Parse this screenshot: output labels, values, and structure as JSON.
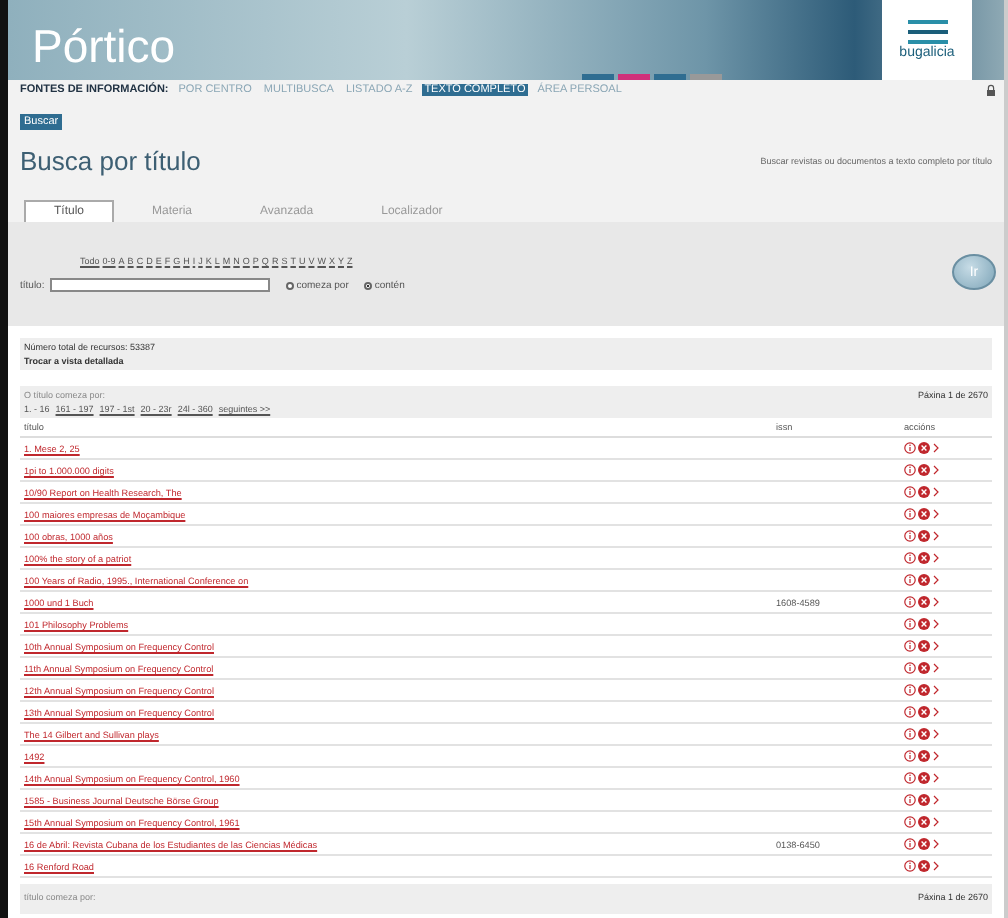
{
  "header": {
    "logo": "Pórtico",
    "brand": "bugalicia"
  },
  "nav": {
    "label": "FONTES DE INFORMACIÓN:",
    "items": [
      {
        "label": "POR CENTRO",
        "selected": false
      },
      {
        "label": "MULTIBUSCA",
        "selected": false
      },
      {
        "label": "LISTADO A-Z",
        "selected": false
      },
      {
        "label": "TEXTO COMPLETO",
        "selected": true
      },
      {
        "label": "ÁREA PERSOAL",
        "selected": false
      }
    ],
    "sub_button": "Buscar"
  },
  "page": {
    "title": "Busca por título",
    "description": "Buscar revistas ou documentos a texto completo por título"
  },
  "tabs": [
    {
      "label": "Título",
      "selected": true
    },
    {
      "label": "Materia",
      "selected": false
    },
    {
      "label": "Avanzada",
      "selected": false
    },
    {
      "label": "Localizador",
      "selected": false
    }
  ],
  "search": {
    "letters": [
      "Todo",
      "0-9",
      "A",
      "B",
      "C",
      "D",
      "E",
      "F",
      "G",
      "H",
      "I",
      "J",
      "K",
      "L",
      "M",
      "N",
      "O",
      "P",
      "Q",
      "R",
      "S",
      "T",
      "U",
      "V",
      "W",
      "X",
      "Y",
      "Z"
    ],
    "field_label": "título:",
    "options": [
      {
        "label": "comeza por",
        "selected": false
      },
      {
        "label": "contén",
        "selected": true
      }
    ],
    "go_button": "Ir"
  },
  "summary": {
    "total": "Número total de recursos: 53387",
    "view_link": "Trocar a vista detallada"
  },
  "results": {
    "prefix_label": "O título comeza por:",
    "page_info": "Páxina 1 de 2670",
    "pages": [
      {
        "label": "1. - 16",
        "selected": true
      },
      {
        "label": "161 - 197",
        "selected": false
      },
      {
        "label": "197 - 1st",
        "selected": false
      },
      {
        "label": "20 - 23r",
        "selected": false
      },
      {
        "label": "24l - 360",
        "selected": false
      },
      {
        "label": "seguintes >>",
        "selected": false
      }
    ],
    "columns": [
      "título",
      "issn",
      "accións"
    ],
    "rows": [
      {
        "title": "1. Mese 2, 25",
        "issn": ""
      },
      {
        "title": "1pi to 1.000.000 digits",
        "issn": ""
      },
      {
        "title": "10/90 Report on Health Research, The",
        "issn": ""
      },
      {
        "title": "100 maiores empresas de Moçambique",
        "issn": ""
      },
      {
        "title": "100 obras, 1000 años",
        "issn": ""
      },
      {
        "title": "100% the story of a patriot",
        "issn": ""
      },
      {
        "title": "100 Years of Radio, 1995., International Conference on",
        "issn": ""
      },
      {
        "title": "1000 und 1 Buch",
        "issn": "1608-4589"
      },
      {
        "title": "101 Philosophy Problems",
        "issn": ""
      },
      {
        "title": "10th Annual Symposium on Frequency Control",
        "issn": ""
      },
      {
        "title": "11th Annual Symposium on Frequency Control",
        "issn": ""
      },
      {
        "title": "12th Annual Symposium on Frequency Control",
        "issn": ""
      },
      {
        "title": "13th Annual Symposium on Frequency Control",
        "issn": ""
      },
      {
        "title": "The 14 Gilbert and Sullivan plays",
        "issn": ""
      },
      {
        "title": "1492",
        "issn": ""
      },
      {
        "title": "14th Annual Symposium on Frequency Control, 1960",
        "issn": ""
      },
      {
        "title": "1585 - Business Journal Deutsche Börse Group",
        "issn": ""
      },
      {
        "title": "15th Annual Symposium on Frequency Control, 1961",
        "issn": ""
      },
      {
        "title": "16 de Abril: Revista Cubana de los Estudiantes de las Ciencias Médicas",
        "issn": "0138-6450"
      },
      {
        "title": "16 Renford Road",
        "issn": ""
      }
    ]
  },
  "footer": {
    "prefix_label": "título comeza por:",
    "page_info": "Páxina 1 de 2670"
  }
}
